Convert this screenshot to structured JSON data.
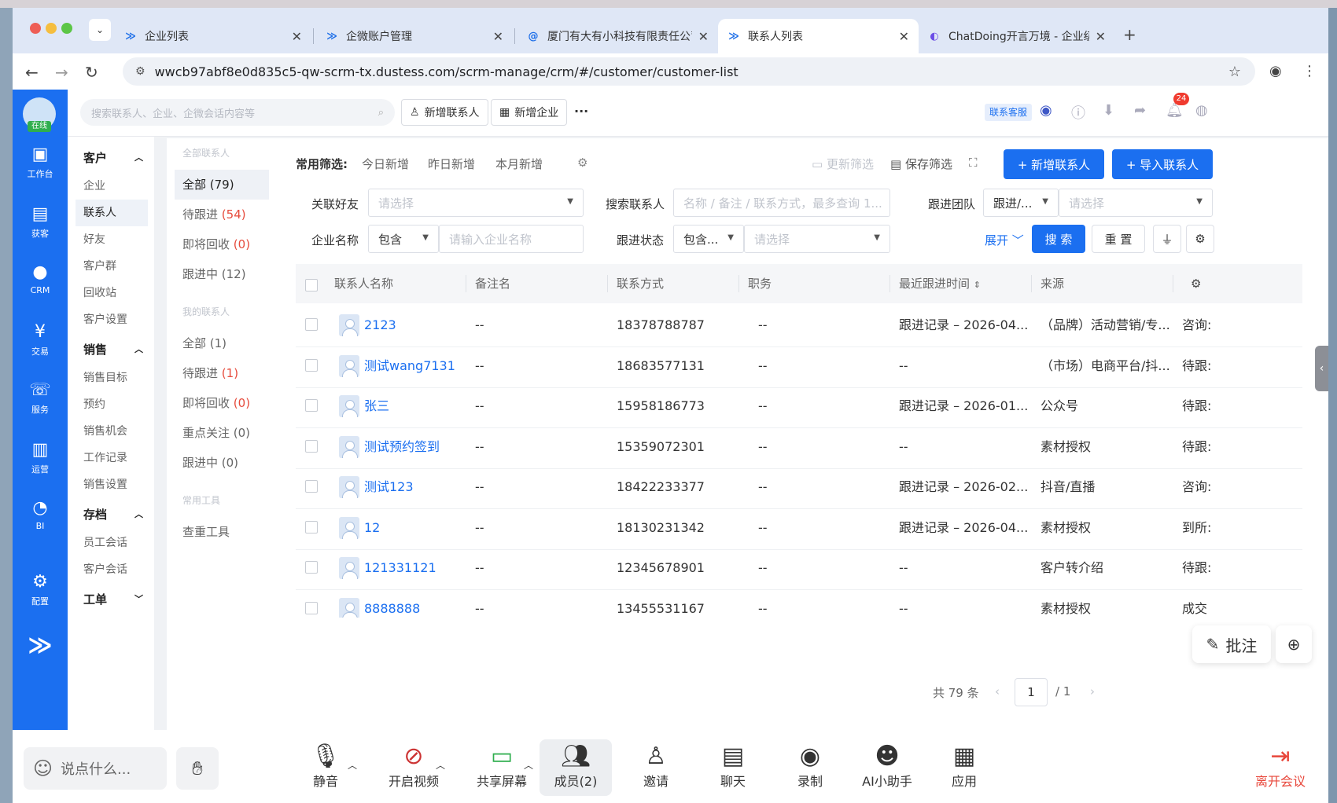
{
  "browser": {
    "tabs": [
      {
        "label": "企业列表",
        "icon": "dustess-logo-icon"
      },
      {
        "label": "企微账户管理",
        "icon": "dustess-logo-icon"
      },
      {
        "label": "厦门有大有小科技有限责任公司",
        "icon": "at-sign-icon"
      },
      {
        "label": "联系人列表",
        "icon": "dustess-logo-icon",
        "active": true
      },
      {
        "label": "ChatDoing开言万境 - 企业级AI",
        "icon": "chatdoing-icon"
      }
    ],
    "url": "wwcb97abf8e0d835c5-qw-scrm-tx.dustess.com/scrm-manage/crm/#/customer/customer-list"
  },
  "left_nav": {
    "status": "在线",
    "items": [
      {
        "label": "工作台",
        "icon": "workbench-icon"
      },
      {
        "label": "获客",
        "icon": "acquire-icon"
      },
      {
        "label": "CRM",
        "icon": "user-icon"
      },
      {
        "label": "交易",
        "icon": "yen-icon"
      },
      {
        "label": "服务",
        "icon": "phone-icon"
      },
      {
        "label": "运营",
        "icon": "bar-chart-icon"
      },
      {
        "label": "BI",
        "icon": "pie-chart-icon"
      },
      {
        "label": "配置",
        "icon": "gear-icon"
      }
    ]
  },
  "topbar": {
    "search_placeholder": "搜索联系人、企业、企微会话内容等",
    "add_contact": "新增联系人",
    "add_company": "新增企业",
    "more": "···",
    "service": "联系客服",
    "notify_count": "24"
  },
  "menu": {
    "customer": "客户",
    "company": "企业",
    "contact": "联系人",
    "friend": "好友",
    "group": "客户群",
    "recycle": "回收站",
    "settings": "客户设置",
    "sales": "销售",
    "sales_target": "销售目标",
    "appointment": "预约",
    "opportunity": "销售机会",
    "work_record": "工作记录",
    "sales_settings": "销售设置",
    "archive": "存档",
    "staff_chat": "员工会话",
    "customer_chat": "客户会话",
    "ticket": "工单"
  },
  "views": {
    "all_group": "全部联系人",
    "all": "全部 (79)",
    "pending_label": "待跟进",
    "pending_count": "(54)",
    "recycle_label": "即将回收",
    "recycle_count": "(0)",
    "following": "跟进中 (12)",
    "mine_group": "我的联系人",
    "mine_all": "全部 (1)",
    "mine_pending_label": "待跟进",
    "mine_pending_count": "(1)",
    "mine_recycle_label": "即将回收",
    "mine_recycle_count": "(0)",
    "focus": "重点关注 (0)",
    "mine_following": "跟进中 (0)",
    "tools_group": "常用工具",
    "dedupe": "查重工具"
  },
  "filters": {
    "common_label": "常用筛选:",
    "quick": [
      "今日新增",
      "昨日新增",
      "本月新增"
    ],
    "update": "更新筛选",
    "save": "保存筛选",
    "new_contact": "+ 新增联系人",
    "import_contact": "+ 导入联系人",
    "friend_label": "关联好友",
    "friend_ph": "请选择",
    "search_label": "搜索联系人",
    "search_ph": "名称 / 备注 / 联系方式，最多查询 1...",
    "team_label": "跟进团队",
    "team_val": "跟进/...",
    "team_ph": "请选择",
    "company_label": "企业名称",
    "company_op": "包含",
    "company_ph": "请输入企业名称",
    "status_label": "跟进状态",
    "status_op": "包含...",
    "status_ph": "请选择",
    "expand": "展开",
    "search_btn": "搜 索",
    "reset_btn": "重 置"
  },
  "table": {
    "columns": [
      "联系人名称",
      "备注名",
      "联系方式",
      "职务",
      "最近跟进时间",
      "来源"
    ],
    "rows": [
      {
        "name": "2123",
        "remark": "--",
        "phone": "18378788787",
        "title": "--",
        "last": "跟进记录 – 2026-04...",
        "source": "（品牌）活动营销/专...",
        "status": "咨询:"
      },
      {
        "name": "测试wang7131",
        "remark": "--",
        "phone": "18683577131",
        "title": "--",
        "last": "--",
        "source": "（市场）电商平台/抖...",
        "status": "待跟:"
      },
      {
        "name": "张三",
        "remark": "--",
        "phone": "15958186773",
        "title": "--",
        "last": "跟进记录 – 2026-01...",
        "source": "公众号",
        "status": "待跟:"
      },
      {
        "name": "测试预约签到",
        "remark": "--",
        "phone": "15359072301",
        "title": "--",
        "last": "--",
        "source": "素材授权",
        "status": "待跟:"
      },
      {
        "name": "测试123",
        "remark": "--",
        "phone": "18422233377",
        "title": "--",
        "last": "跟进记录 – 2026-02...",
        "source": "抖音/直播",
        "status": "咨询:"
      },
      {
        "name": "12",
        "remark": "--",
        "phone": "18130231342",
        "title": "--",
        "last": "跟进记录 – 2026-04...",
        "source": "素材授权",
        "status": "到所:"
      },
      {
        "name": "121331121",
        "remark": "--",
        "phone": "12345678901",
        "title": "--",
        "last": "--",
        "source": "客户转介绍",
        "status": "待跟:"
      },
      {
        "name": "8888888",
        "remark": "--",
        "phone": "13455531167",
        "title": "--",
        "last": "--",
        "source": "素材授权",
        "status": "成交"
      }
    ]
  },
  "pagination": {
    "total": "共 79 条",
    "page": "1",
    "pages": "/ 1"
  },
  "annotate": "批注",
  "meeting": {
    "chat_placeholder": "说点什么...",
    "buttons": [
      {
        "label": "静音",
        "icon": "microphone-icon"
      },
      {
        "label": "开启视频",
        "icon": "camera-off-icon"
      },
      {
        "label": "共享屏幕",
        "icon": "share-screen-icon"
      },
      {
        "label": "成员(2)",
        "icon": "members-icon"
      },
      {
        "label": "邀请",
        "icon": "invite-icon"
      },
      {
        "label": "聊天",
        "icon": "chat-icon"
      },
      {
        "label": "录制",
        "icon": "record-icon"
      },
      {
        "label": "AI小助手",
        "icon": "ai-assistant-icon"
      },
      {
        "label": "应用",
        "icon": "apps-icon"
      }
    ],
    "leave": "离开会议"
  },
  "colors": {
    "primary": "#1b6ff0",
    "danger": "#e64b3c",
    "leave": "#e8473b"
  }
}
